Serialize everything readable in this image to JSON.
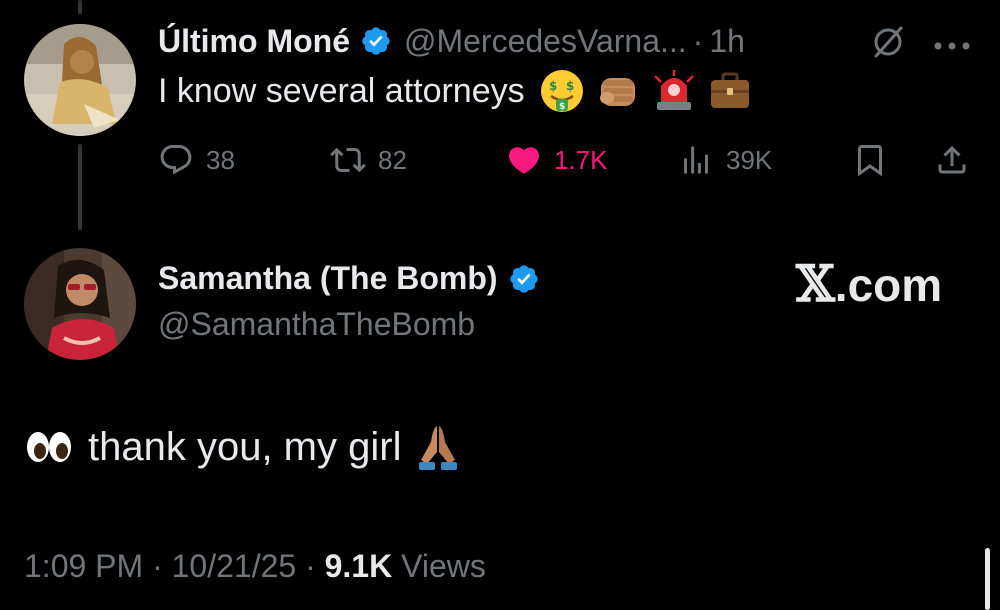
{
  "tweet1": {
    "display_name": "Último Moné",
    "handle": "@MercedesVarna...",
    "dot": "·",
    "time": "1h",
    "text": "I know several attorneys",
    "emojis": [
      "money-mouth-face",
      "oncoming-fist",
      "police-light",
      "briefcase"
    ],
    "actions": {
      "replies": "38",
      "reposts": "82",
      "likes": "1.7K",
      "views": "39K"
    }
  },
  "tweet2": {
    "display_name": "Samantha (The Bomb)",
    "handle": "@SamanthaTheBomb",
    "body_text": "thank you, my girl",
    "emojis": [
      "eyes",
      "folded-hands"
    ],
    "meta": {
      "time": "1:09 PM",
      "sep": "·",
      "date": "10/21/25",
      "views_count": "9.1K",
      "views_label": "Views"
    }
  },
  "watermark": {
    "x": "𝕏",
    "domain": ".com"
  },
  "colors": {
    "background": "#000000",
    "text_primary": "#e7e9ea",
    "text_secondary": "#71767b",
    "verified": "#1d9bf0",
    "like": "#f91880"
  }
}
